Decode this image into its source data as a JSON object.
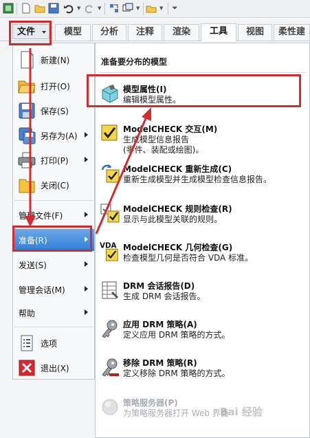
{
  "quick_access": {
    "icons": [
      "app-icon",
      "new-icon",
      "open-icon",
      "save-icon",
      "undo-icon",
      "redo-icon",
      "regenerate-icon",
      "windows-icon",
      "close-window-icon",
      "customize-icon"
    ]
  },
  "ribbon": {
    "file_tab": "文件",
    "tabs": [
      "模型",
      "分析",
      "注释",
      "渲染",
      "工具",
      "视图",
      "柔性建"
    ],
    "active_tab": "工具"
  },
  "file_menu": {
    "items": [
      {
        "label": "新建(N)",
        "icon": "new-document-icon",
        "submenu": false
      },
      {
        "label": "打开(O)",
        "icon": "open-folder-icon",
        "submenu": false
      },
      {
        "label": "保存(S)",
        "icon": "save-disk-icon",
        "submenu": false
      },
      {
        "label": "另存为(A)",
        "icon": "save-as-icon",
        "submenu": true
      },
      {
        "label": "打印(P)",
        "icon": "printer-icon",
        "submenu": true
      },
      {
        "label": "关闭(C)",
        "icon": "close-folder-icon",
        "submenu": false
      },
      {
        "label": "管理文件(F)",
        "submenu": true
      },
      {
        "label": "准备(R)",
        "submenu": true,
        "active": true
      },
      {
        "label": "发送(S)",
        "submenu": true
      },
      {
        "label": "管理会话(M)",
        "submenu": true
      },
      {
        "label": "帮助",
        "submenu": true
      },
      {
        "label": "选项",
        "icon": "options-icon",
        "submenu": false
      },
      {
        "label": "退出(X)",
        "icon": "exit-icon",
        "submenu": false
      }
    ]
  },
  "prepare_panel": {
    "title": "准备要分布的模型",
    "items": [
      {
        "title": "模型属性(I)",
        "desc": "编辑模型属性。",
        "icon": "model-properties-icon"
      },
      {
        "title": "ModelCHECK 交互(M)",
        "desc": "生成模型信息报告\n(零件、装配或绘图)。",
        "icon": "modelcheck-interactive-icon"
      },
      {
        "title": "ModelCHECK 重新生成(C)",
        "desc": "重新生成模型并生成模型检查信息报告。",
        "icon": "modelcheck-regenerate-icon"
      },
      {
        "title": "ModelCHECK 规则检查(R)",
        "desc": "显示与此模型关联的规则。",
        "icon": "modelcheck-rules-icon"
      },
      {
        "title": "ModelCHECK 几何检查(G)",
        "desc": "检查模型几何是否符合 VDA 标准。",
        "icon": "vda-geometry-check-icon",
        "icon_text": "VDA"
      },
      {
        "title": "DRM 会话报告(D)",
        "desc": "生成 DRM 会话报告。",
        "icon": "drm-report-icon"
      },
      {
        "title": "应用 DRM 策略(A)",
        "desc": "定义应用 DRM 策略的方式。",
        "icon": "apply-drm-policy-icon"
      },
      {
        "title": "移除 DRM 策略(R)",
        "desc": "定义移除 DRM 策略的方式。",
        "icon": "remove-drm-policy-icon"
      },
      {
        "title": "策略服务器(P)",
        "desc": "为策略服务器打开 Web 界面",
        "icon": "policy-server-icon",
        "disabled": true
      }
    ]
  },
  "watermark": "Bai 经验",
  "colors": {
    "highlight": "#d42b2f",
    "active_menu": "#2f7fd6"
  }
}
